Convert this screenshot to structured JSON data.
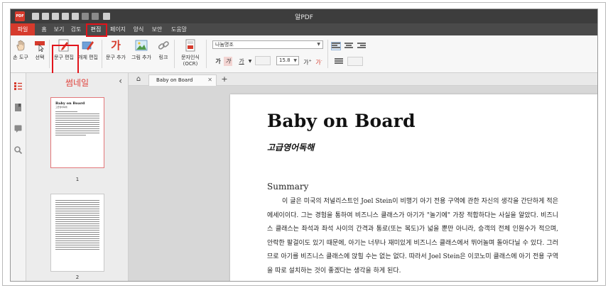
{
  "window": {
    "title": "알PDF",
    "logo_text": "PDF"
  },
  "menu": {
    "items": [
      {
        "label": "파일"
      },
      {
        "label": "홈"
      },
      {
        "label": "보기"
      },
      {
        "label": "검토"
      },
      {
        "label": "편집"
      },
      {
        "label": "페이지"
      },
      {
        "label": "양식"
      },
      {
        "label": "보안"
      },
      {
        "label": "도움말"
      }
    ],
    "active": "편집"
  },
  "ribbon": {
    "hand_tool": "손 도구",
    "select": "선택",
    "edit_text": "문구 편집",
    "edit_object": "개체 편집",
    "add_text": "문구 추가",
    "add_image": "그림 추가",
    "link": "링크",
    "ocr_line1": "문자인식",
    "ocr_line2": "(OCR)",
    "font_name": "나눔명조",
    "font_size": "15.8",
    "bold_glyph": "가",
    "italic_glyph": "가",
    "underline_glyph": "가",
    "grow_glyph": "가",
    "shrink_glyph": "가",
    "add_text_glyph": "가"
  },
  "thumbnails": {
    "title": "썸네일",
    "pages": [
      {
        "number": "1",
        "title": "Baby on Board",
        "subtitle": "고급영어독해"
      },
      {
        "number": "2"
      }
    ]
  },
  "tabs": {
    "document_tab": "Baby on Board",
    "close": "✕",
    "add": "+"
  },
  "document": {
    "title": "Baby on Board",
    "subtitle": "고급영어독해",
    "section": "Summary",
    "paragraph": "이 글은 미국의 저널리스트인 Joel Stein이 비행기 아기 전용 구역에 관한 자신의 생각을 간단하게 적은 에세이이다. 그는 경험을 통하여 비즈니스 클래스가 아기가 \"놀기에\" 가장 적합하다는 사실을 알았다. 비즈니스 클래스는 좌석과 좌석 사이의 간격과 통로(또는 복도)가 넓을 뿐만 아니라, 승객의 전체 인원수가 적으며, 안락한 팔걸이도 있기 때문에, 아기는 너무나 재미있게 비즈니스 클래스에서 뛰어놀며 돌아다닐 수 있다. 그러므로 아기를 비즈니스 클래스에 앉힐 수는 없는 없다. 따라서 Joel Stein은 이코노미 클래스에 아기 전용 구역을 따로 설치하는 것이 좋겠다는 생각을 하게 된다."
  },
  "colors": {
    "accent": "#d63a2c",
    "highlight_box": "#e2141b",
    "title_bar": "#3d3d3d",
    "menu_bar": "#4a4a4a"
  }
}
